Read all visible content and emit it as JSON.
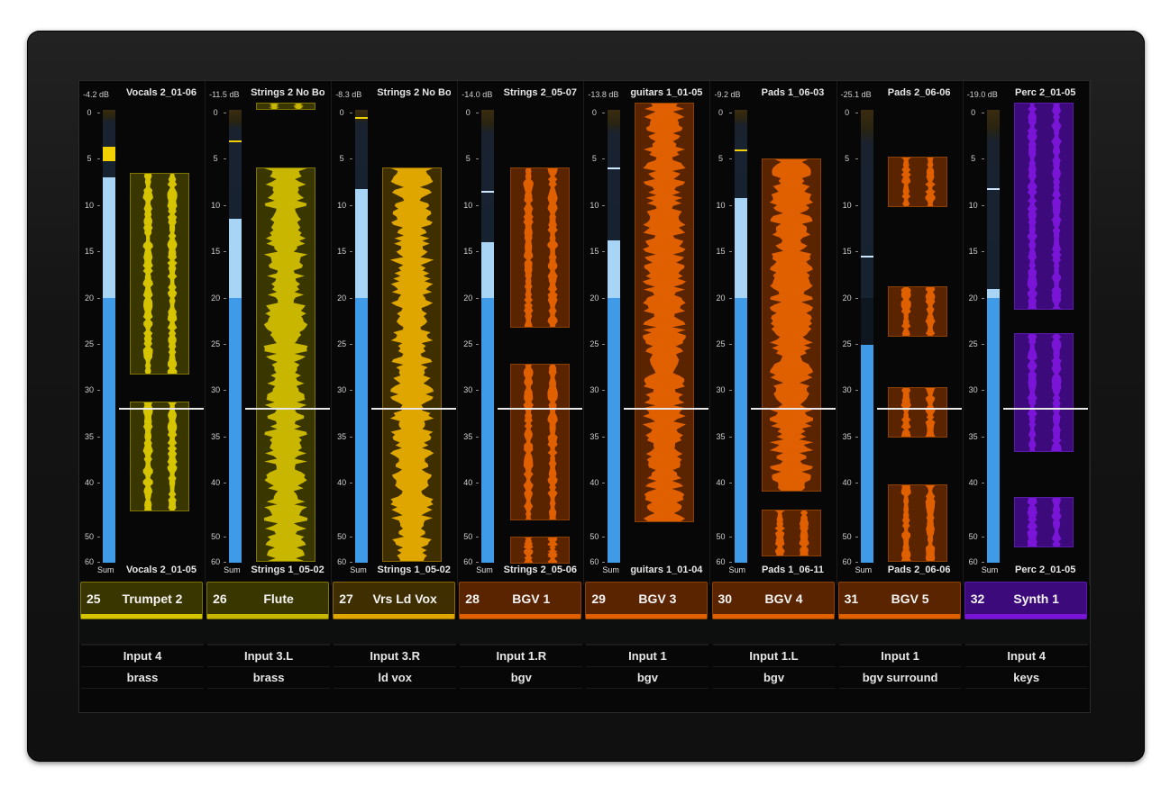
{
  "scale": [
    "0",
    "5",
    "10",
    "15",
    "20",
    "25",
    "30",
    "35",
    "40",
    "50",
    "60"
  ],
  "sum_label": "Sum",
  "channels": [
    {
      "num": "25",
      "name": "Trumpet 2",
      "db": "-4.2 dB",
      "clip_top": "Vocals 2_01-06",
      "clip_bottom": "Vocals 2_01-05",
      "input": "Input 4",
      "group": "brass",
      "color": "#d6c400",
      "bar_bg": "#3a3600",
      "bar_border": "#7e7400",
      "level_db": 7,
      "peak_db": 4.5
    },
    {
      "num": "26",
      "name": "Flute",
      "db": "-11.5 dB",
      "clip_top": "Strings 2 No Bo",
      "clip_bottom": "Strings 1_05-02",
      "input": "Input 3.L",
      "group": "brass",
      "color": "#c8b600",
      "bar_bg": "#3a3600",
      "bar_border": "#7e7400",
      "level_db": 11.5,
      "peak_db": 3
    },
    {
      "num": "27",
      "name": "Vrs Ld Vox",
      "db": "-8.3 dB",
      "clip_top": "Strings 2 No Bo",
      "clip_bottom": "Strings 1_05-02",
      "input": "Input 3.R",
      "group": "ld vox",
      "color": "#e0a600",
      "bar_bg": "#3e2e00",
      "bar_border": "#8a6600",
      "level_db": 8.3,
      "peak_db": 0.5
    },
    {
      "num": "28",
      "name": "BGV 1",
      "db": "-14.0 dB",
      "clip_top": "Strings 2_05-07",
      "clip_bottom": "Strings 2_05-06",
      "input": "Input 1.R",
      "group": "bgv",
      "color": "#e06000",
      "bar_bg": "#5a2400",
      "bar_border": "#8c4000",
      "level_db": 14,
      "peak_db": 8.5
    },
    {
      "num": "29",
      "name": "BGV 3",
      "db": "-13.8 dB",
      "clip_top": "guitars 1_01-05",
      "clip_bottom": "guitars 1_01-04",
      "input": "Input 1",
      "group": "bgv",
      "color": "#e06000",
      "bar_bg": "#5a2400",
      "bar_border": "#8c4000",
      "level_db": 13.8,
      "peak_db": 6
    },
    {
      "num": "30",
      "name": "BGV 4",
      "db": "-9.2 dB",
      "clip_top": "Pads 1_06-03",
      "clip_bottom": "Pads 1_06-11",
      "input": "Input 1.L",
      "group": "bgv",
      "color": "#e06000",
      "bar_bg": "#5a2400",
      "bar_border": "#8c4000",
      "level_db": 9.2,
      "peak_db": 4
    },
    {
      "num": "31",
      "name": "BGV 5",
      "db": "-25.1 dB",
      "clip_top": "Pads 2_06-06",
      "clip_bottom": "Pads 2_06-06",
      "input": "Input 1",
      "group": "bgv surround",
      "color": "#e06000",
      "bar_bg": "#5a2400",
      "bar_border": "#8c4000",
      "level_db": 25.1,
      "peak_db": 15.5
    },
    {
      "num": "32",
      "name": "Synth 1",
      "db": "-19.0 dB",
      "clip_top": "Perc 2_01-05",
      "clip_bottom": "Perc 2_01-05",
      "input": "Input 4",
      "group": "keys",
      "color": "#7a14d6",
      "bar_bg": "#3c0a7a",
      "bar_border": "#5a1aa8",
      "level_db": 19,
      "peak_db": 8.2
    }
  ]
}
